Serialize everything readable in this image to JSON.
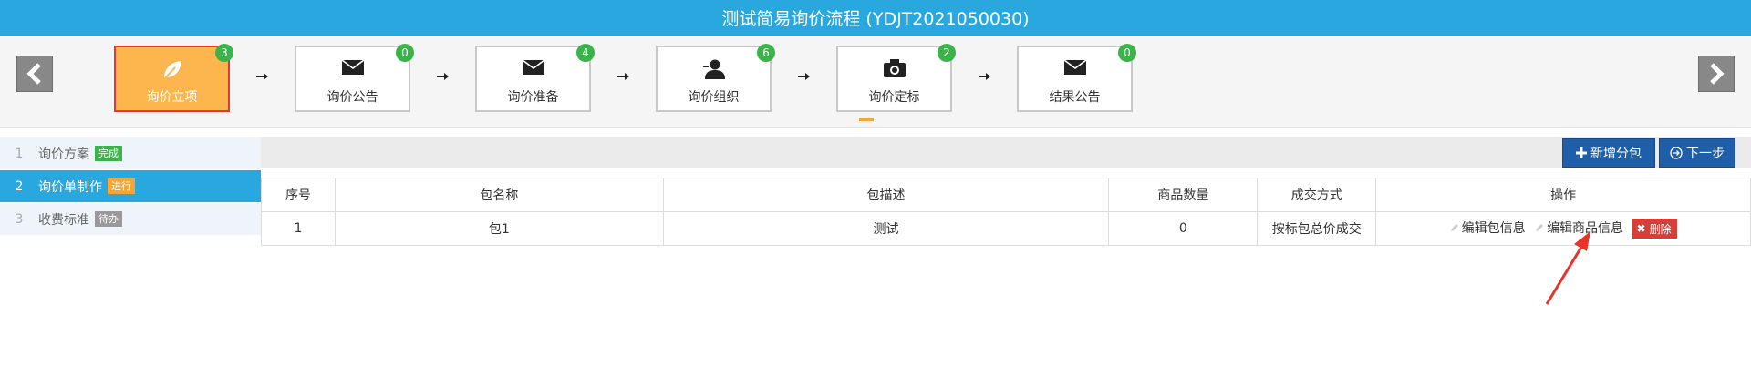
{
  "title": "测试简易询价流程 (YDJT2021050030)",
  "steps": [
    {
      "label": "询价立项",
      "badge": "3",
      "icon": "leaf-icon"
    },
    {
      "label": "询价公告",
      "badge": "0",
      "icon": "envelope-icon"
    },
    {
      "label": "询价准备",
      "badge": "4",
      "icon": "envelope-icon"
    },
    {
      "label": "询价组织",
      "badge": "6",
      "icon": "user-icon"
    },
    {
      "label": "询价定标",
      "badge": "2",
      "icon": "camera-icon"
    },
    {
      "label": "结果公告",
      "badge": "0",
      "icon": "envelope-icon"
    }
  ],
  "sidebar": {
    "items": [
      {
        "num": "1",
        "label": "询价方案",
        "status": "完成"
      },
      {
        "num": "2",
        "label": "询价单制作",
        "status": "进行"
      },
      {
        "num": "3",
        "label": "收费标准",
        "status": "待办"
      }
    ]
  },
  "toolbar": {
    "add_package": "新增分包",
    "next_step": "下一步"
  },
  "table": {
    "headers": [
      "序号",
      "包名称",
      "包描述",
      "商品数量",
      "成交方式",
      "操作"
    ],
    "rows": [
      {
        "index": "1",
        "name": "包1",
        "desc": "测试",
        "qty": "0",
        "method": "按标包总价成交"
      }
    ],
    "ops": {
      "edit_package": "编辑包信息",
      "edit_goods": "编辑商品信息",
      "delete": "删除"
    }
  },
  "colors": {
    "header": "#29a8e0",
    "active_step": "#fcb64d",
    "badge": "#3bb34a",
    "primary_button": "#1f5ea8",
    "delete_button": "#d43f3a",
    "annotation_arrow": "#e8332a"
  }
}
